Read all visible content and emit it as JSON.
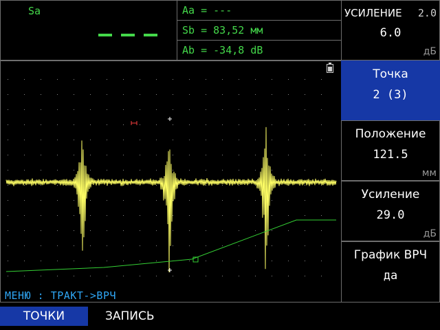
{
  "amplitude_a": {
    "label": "Sa",
    "value_display": "– – –"
  },
  "measurements": [
    {
      "text": "Aa = ---"
    },
    {
      "text": "Sb = 83,52 мм"
    },
    {
      "text": "Ab = -34,8 dB"
    }
  ],
  "gain_header": {
    "title": "УСИЛЕНИЕ",
    "step": "2.0",
    "value": "6.0",
    "unit": "дБ"
  },
  "side_menu": [
    {
      "label": "Точка",
      "value": "2 (3)",
      "unit": "",
      "active": true
    },
    {
      "label": "Положение",
      "value": "121.5",
      "unit": "мм",
      "active": false
    },
    {
      "label": "Усиление",
      "value": "29.0",
      "unit": "дБ",
      "active": false
    },
    {
      "label": "График ВРЧ",
      "value": "да",
      "unit": "",
      "active": false
    }
  ],
  "menu_path": "МЕНЮ : ТРАКТ->ВРЧ",
  "softkeys": [
    {
      "label": "ТОЧКИ",
      "active": true
    },
    {
      "label": "ЗАПИСЬ",
      "active": false
    }
  ],
  "colors": {
    "signal": "#ffff66",
    "tvg_curve": "#35d235",
    "gate": "#ff4040",
    "accent": "#1638a6",
    "menu_text": "#2fa6f4",
    "text_green": "#44d84a"
  },
  "icons": {
    "battery": "battery-icon"
  }
}
